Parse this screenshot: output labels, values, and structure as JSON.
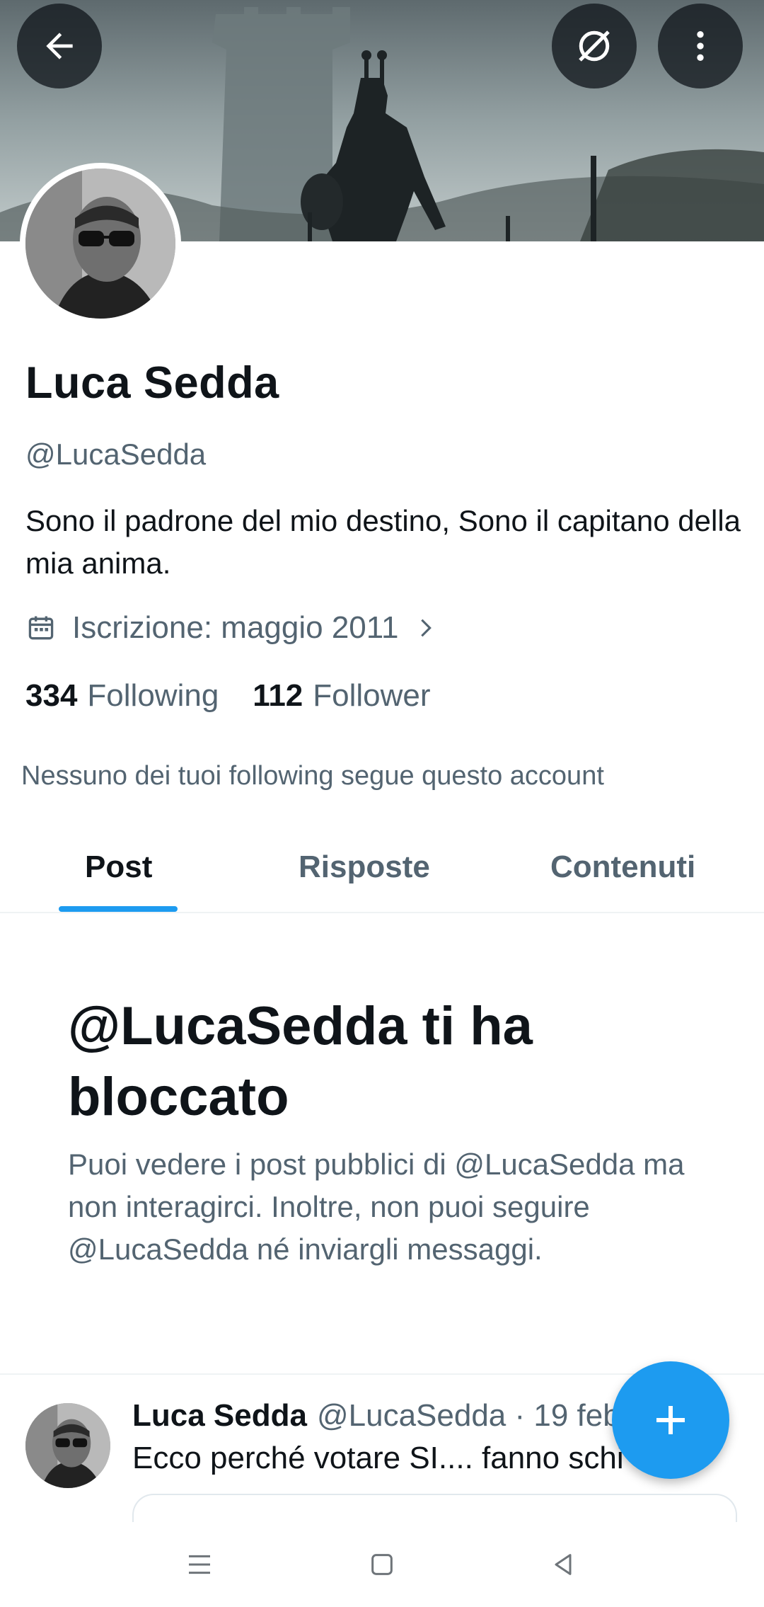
{
  "profile": {
    "name": "Luca Sedda",
    "handle": "@LucaSedda",
    "bio": "Sono il padrone del mio destino, Sono il capitano della mia anima.",
    "joined": "Iscrizione: maggio 2011",
    "following_count": "334",
    "following_label": "Following",
    "followers_count": "112",
    "followers_label": "Follower",
    "mutual_note": "Nessuno dei tuoi following segue questo account"
  },
  "tabs": [
    {
      "label": "Post",
      "active": true
    },
    {
      "label": "Risposte",
      "active": false
    },
    {
      "label": "Contenuti",
      "active": false
    }
  ],
  "blocked": {
    "title": "@LucaSedda ti ha bloccato",
    "description": "Puoi vedere i post pubblici di @LucaSedda ma non interagirci. Inoltre, non puoi seguire @LucaSedda né inviargli messaggi."
  },
  "post": {
    "author": "Luca Sedda",
    "meta": "@LucaSedda · 19 feb",
    "text": "Ecco perché votare SI.... fanno schi"
  },
  "icons": {
    "back": "arrow-left-icon",
    "grok": "slashed-circle-icon",
    "more": "vertical-dots-icon",
    "calendar": "calendar-icon",
    "chevron": "chevron-right-icon",
    "compose": "plus-icon",
    "nav_menu": "menu-lines-icon",
    "nav_home": "square-icon",
    "nav_back": "triangle-back-icon"
  },
  "colors": {
    "accent": "#1d9bf0",
    "secondary_text": "#536471"
  }
}
